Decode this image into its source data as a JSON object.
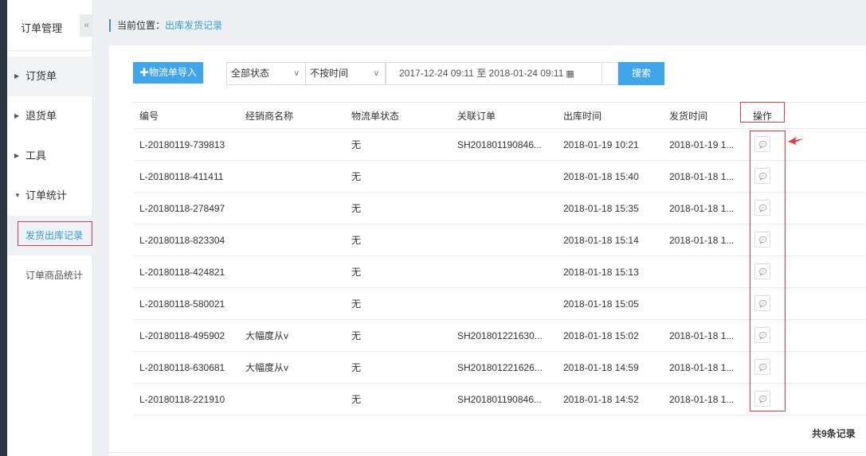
{
  "sidebar": {
    "title": "订单管理",
    "collapse_icon": "«",
    "items": [
      {
        "label": "订货单"
      },
      {
        "label": "退货单"
      },
      {
        "label": "工具"
      },
      {
        "label": "订单统计"
      }
    ],
    "sub_items": [
      {
        "label": "发货出库记录"
      },
      {
        "label": "订单商品统计"
      }
    ]
  },
  "breadcrumb": {
    "label": "当前位置：",
    "current": "出库发货记录"
  },
  "toolbar": {
    "import_label": "✚物流单导入",
    "status_select": "全部状态",
    "time_select": "不按时间",
    "date_range": "2017-12-24 09:11 至 2018-01-24 09:11",
    "search_label": "搜索"
  },
  "table": {
    "headers": [
      "编号",
      "经销商名称",
      "物流单状态",
      "关联订单",
      "出库时间",
      "发货时间",
      "操作"
    ],
    "rows": [
      [
        "L-20180119-739813",
        "",
        "无",
        "SH201801190846...",
        "2018-01-19 10:21",
        "2018-01-19 1..."
      ],
      [
        "L-20180118-411411",
        "",
        "无",
        "",
        "2018-01-18 15:40",
        "2018-01-18 1..."
      ],
      [
        "L-20180118-278497",
        "",
        "无",
        "",
        "2018-01-18 15:35",
        "2018-01-18 1..."
      ],
      [
        "L-20180118-823304",
        "",
        "无",
        "",
        "2018-01-18 15:14",
        "2018-01-18 1..."
      ],
      [
        "L-20180118-424821",
        "",
        "无",
        "",
        "2018-01-18 15:13",
        ""
      ],
      [
        "L-20180118-580021",
        "",
        "无",
        "",
        "2018-01-18 15:05",
        ""
      ],
      [
        "L-20180118-495902",
        "大幅度从v",
        "无",
        "SH201801221630...",
        "2018-01-18 15:02",
        "2018-01-18 1..."
      ],
      [
        "L-20180118-630681",
        "大幅度从v",
        "无",
        "SH201801221626...",
        "2018-01-18 14:59",
        "2018-01-18 1..."
      ],
      [
        "L-20180118-221910",
        "",
        "无",
        "SH201801190846...",
        "2018-01-18 14:52",
        "2018-01-18 1..."
      ]
    ]
  },
  "footer": {
    "total": "共9条记录"
  },
  "colors": {
    "accent": "#40a5ea",
    "highlight": "#e23b3b",
    "sidebar_dark": "#2f3540"
  }
}
